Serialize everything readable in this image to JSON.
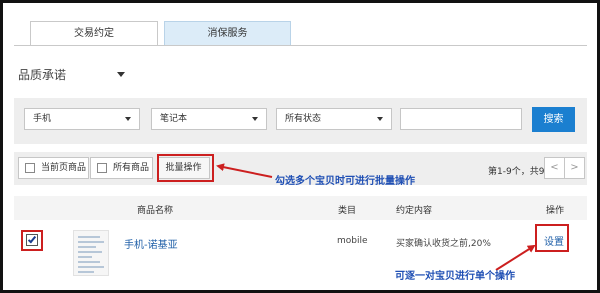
{
  "tabs": [
    {
      "label": "交易约定",
      "active": true
    },
    {
      "label": "消保服务",
      "active": false
    }
  ],
  "quality_filter": {
    "label": "品质承诺"
  },
  "filters": {
    "category_1": "手机",
    "category_2": "笔记本",
    "status": "所有状态",
    "search_value": "",
    "search_button": "搜索"
  },
  "actions": {
    "select_page": "当前页商品",
    "select_all": "所有商品",
    "batch": "批量操作",
    "pager_text": "第1-9个，共9个",
    "prev": "<",
    "next": ">"
  },
  "annotations": {
    "batch_hint": "勾选多个宝贝时可进行批量操作",
    "single_hint": "可逐一对宝贝进行单个操作"
  },
  "table": {
    "headers": {
      "name": "商品名称",
      "category": "类目",
      "content": "约定内容",
      "operation": "操作"
    },
    "rows": [
      {
        "checked": true,
        "name": "手机-诺基亚",
        "category": "mobile",
        "content": "买家确认收货之前,20%",
        "action": "设置"
      }
    ]
  },
  "colors": {
    "accent": "#1b7fd0",
    "annotation": "#1f4fb4",
    "highlight": "#cc1f1f",
    "link": "#1f5fa8"
  }
}
